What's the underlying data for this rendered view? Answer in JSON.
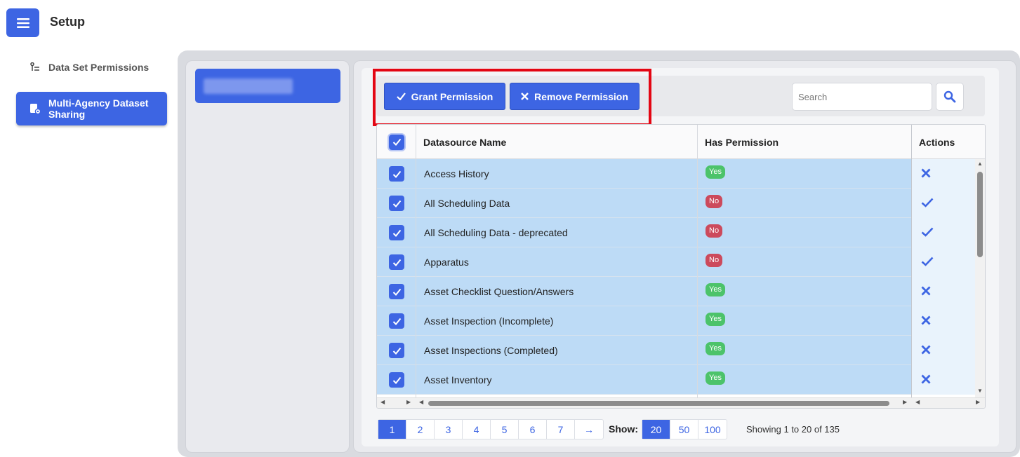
{
  "app": {
    "title": "Setup"
  },
  "sidebar": {
    "items": [
      {
        "label": "Data Set Permissions",
        "icon": "tree-list-icon",
        "active": false
      },
      {
        "label": "Multi-Agency Dataset Sharing",
        "icon": "share-document-icon",
        "active": true
      }
    ]
  },
  "toolbar": {
    "grant_label": "Grant Permission",
    "remove_label": "Remove Permission",
    "search_placeholder": "Search"
  },
  "table": {
    "columns": [
      "Datasource Name",
      "Has Permission",
      "Actions"
    ],
    "rows": [
      {
        "name": "Access History",
        "has_permission": "Yes",
        "action": "remove"
      },
      {
        "name": "All Scheduling Data",
        "has_permission": "No",
        "action": "grant"
      },
      {
        "name": "All Scheduling Data - deprecated",
        "has_permission": "No",
        "action": "grant"
      },
      {
        "name": "Apparatus",
        "has_permission": "No",
        "action": "grant"
      },
      {
        "name": "Asset Checklist Question/Answers",
        "has_permission": "Yes",
        "action": "remove"
      },
      {
        "name": "Asset Inspection (Incomplete)",
        "has_permission": "Yes",
        "action": "remove"
      },
      {
        "name": "Asset Inspections (Completed)",
        "has_permission": "Yes",
        "action": "remove"
      },
      {
        "name": "Asset Inventory",
        "has_permission": "Yes",
        "action": "remove"
      }
    ]
  },
  "pagination": {
    "pages": [
      "1",
      "2",
      "3",
      "4",
      "5",
      "6",
      "7"
    ],
    "next_label": "→",
    "current_page": "1",
    "show_label": "Show:",
    "page_sizes": [
      "20",
      "50",
      "100"
    ],
    "current_size": "20",
    "showing_text": "Showing 1 to 20 of 135"
  },
  "colors": {
    "accent": "#3d65e3",
    "row_selected": "#bddbf6",
    "yes_badge": "#4cc36a",
    "no_badge": "#cc4a5c",
    "highlight_box": "#e30613"
  }
}
